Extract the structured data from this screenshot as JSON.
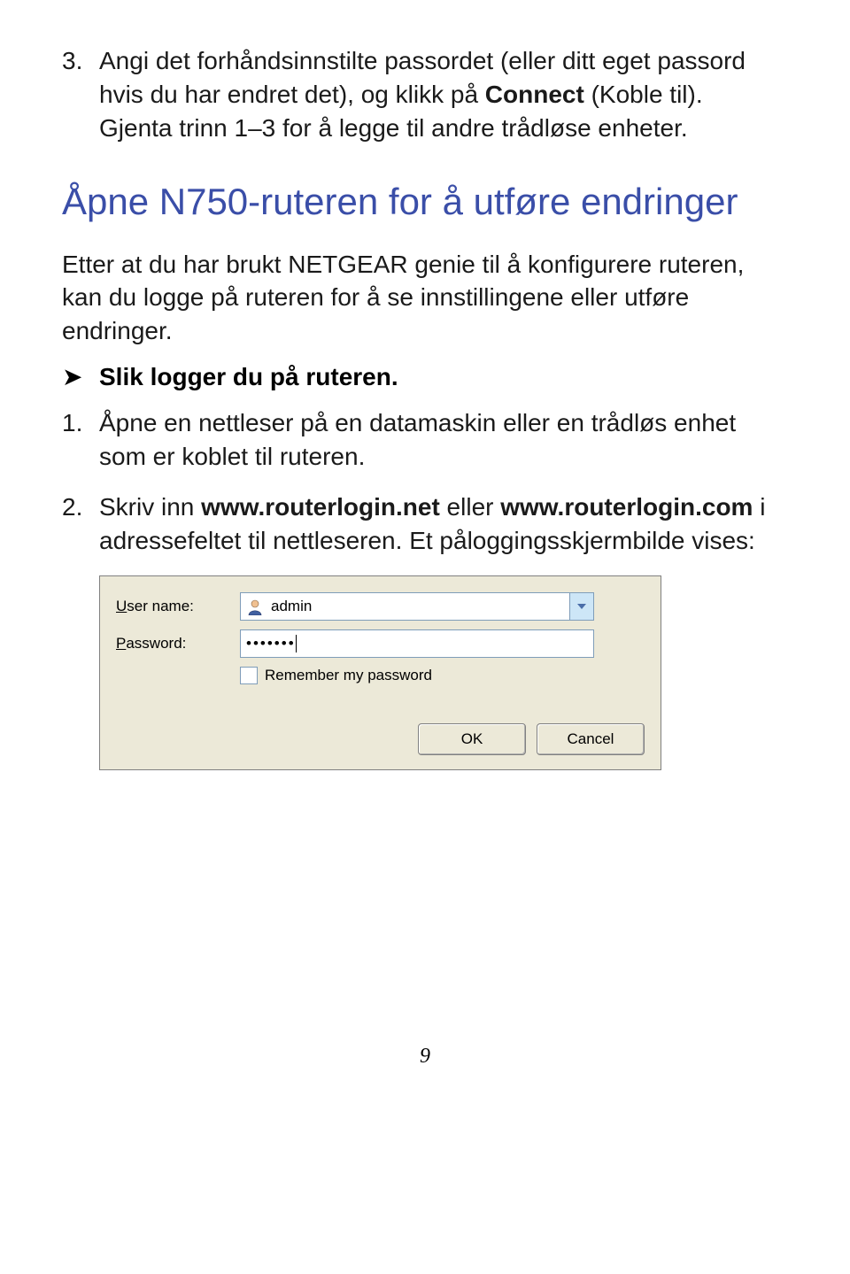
{
  "step3": {
    "num": "3.",
    "text_a": "Angi det forhåndsinnstilte passordet (eller ditt eget passord hvis du har endret det), og klikk på ",
    "text_bold": "Connect",
    "text_b": " (Koble til). Gjenta trinn 1–3 for å legge til andre trådløse enheter."
  },
  "heading": "Åpne N750-ruteren for å utføre endringer",
  "intro": "Etter at du har brukt NETGEAR genie til å konfigurere ruteren, kan du logge på ruteren for å se innstillingene eller utføre endringer.",
  "bullet_mark": "➤",
  "bullet_text": "Slik logger du på ruteren.",
  "step1": {
    "num": "1.",
    "text": "Åpne en nettleser på en datamaskin eller en trådløs enhet som er koblet til ruteren."
  },
  "step2": {
    "num": "2.",
    "text_a": "Skriv inn ",
    "bold1": "www.routerlogin.net",
    "text_b": " eller ",
    "bold2": "www.routerlogin.com",
    "text_c": " i adressefeltet til nettleseren. Et påloggingsskjermbilde vises:"
  },
  "dialog": {
    "user_label_pre": "U",
    "user_label_rest": "ser name:",
    "user_value": "admin",
    "pass_label_pre": "P",
    "pass_label_rest": "assword:",
    "pass_value": "•••••••",
    "remember_pre": "R",
    "remember_rest": "emember my password",
    "ok": "OK",
    "cancel": "Cancel"
  },
  "page_number": "9"
}
